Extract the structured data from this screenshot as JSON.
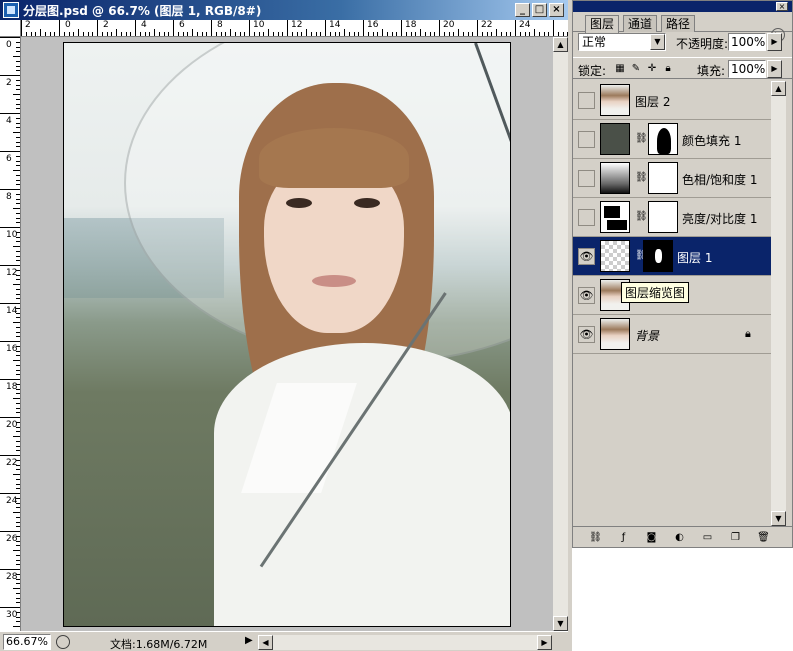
{
  "document": {
    "title": "分层图.psd @ 66.7% (图层 1, RGB/8#)",
    "ruler_top": [
      "2",
      "0",
      "2",
      "4",
      "6",
      "8",
      "10",
      "12",
      "14",
      "16",
      "18",
      "20",
      "22",
      "24"
    ],
    "ruler_left": [
      "0",
      "2",
      "4",
      "6",
      "8",
      "10",
      "12",
      "14",
      "16",
      "18",
      "20",
      "22",
      "24",
      "26",
      "28",
      "30"
    ],
    "zoom": "66.67%",
    "doc_info": "文档:1.68M/6.72M"
  },
  "layers_panel": {
    "tabs": [
      {
        "label": "图层",
        "active": true
      },
      {
        "label": "通道",
        "active": false
      },
      {
        "label": "路径",
        "active": false
      }
    ],
    "blend_mode": "正常",
    "opacity_label": "不透明度:",
    "opacity_value": "100%",
    "lock_label": "锁定:",
    "fill_label": "填充:",
    "fill_value": "100%",
    "layers": [
      {
        "name": "图层 2",
        "visible": false,
        "selected": false
      },
      {
        "name": "颜色填充 1",
        "visible": false,
        "selected": false
      },
      {
        "name": "色相/饱和度 1",
        "visible": false,
        "selected": false
      },
      {
        "name": "亮度/对比度 1",
        "visible": false,
        "selected": false
      },
      {
        "name": "图层 1",
        "visible": true,
        "selected": true
      },
      {
        "name": "",
        "visible": true,
        "selected": false
      },
      {
        "name": "背景",
        "visible": true,
        "selected": false,
        "locked": true
      }
    ],
    "tooltip": "图层缩览图"
  },
  "colors": {
    "selection": "#0a246a",
    "chrome": "#d4d0c8"
  }
}
